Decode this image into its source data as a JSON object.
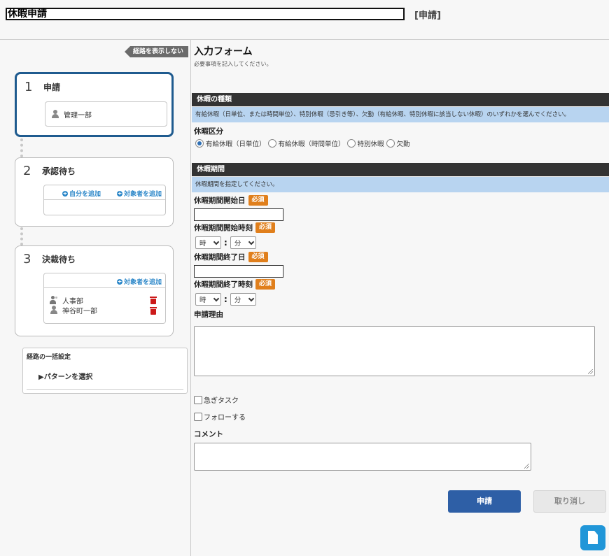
{
  "header": {
    "title": "休暇申請",
    "status": "[申請]"
  },
  "route": {
    "toggle_label": "経路を表示しない",
    "steps": [
      {
        "number": "1",
        "title": "申請",
        "members": [
          "管理一部"
        ]
      },
      {
        "number": "2",
        "title": "承認待ち",
        "add_self": "自分を追加",
        "add_target": "対象者を追加"
      },
      {
        "number": "3",
        "title": "決裁待ち",
        "add_target": "対象者を追加",
        "members": [
          "人事部",
          "神谷町一部"
        ]
      }
    ],
    "bulk": {
      "title": "経路の一括設定",
      "pattern_label": "▶パターンを選択"
    }
  },
  "form": {
    "title": "入力フォーム",
    "subtitle": "必要事項を記入してください。",
    "sections": [
      {
        "heading": "休暇の種類",
        "note": "有給休暇（日単位、または時間単位）、特別休暇（忌引き等）、欠勤（有給休暇、特別休暇に該当しない休暇）のいずれかを選んでください。"
      },
      {
        "heading": "休暇期間",
        "note": "休暇期間を指定してください。"
      }
    ],
    "leave_type": {
      "label": "休暇区分",
      "options": [
        "有給休暇（日単位）",
        "有給休暇（時間単位）",
        "特別休暇",
        "欠勤"
      ],
      "selected": "有給休暇（日単位）"
    },
    "required_badge": "必須",
    "start_date_label": "休暇期間開始日",
    "start_time_label": "休暇期間開始時刻",
    "end_date_label": "休暇期間終了日",
    "end_time_label": "休暇期間終了時刻",
    "hour_placeholder": "時",
    "minute_placeholder": "分",
    "colon": ":",
    "reason_label": "申請理由",
    "urgent_label": "急ぎタスク",
    "follow_label": "フォローする",
    "comment_label": "コメント",
    "submit_label": "申請",
    "cancel_label": "取り消し"
  },
  "icons": {
    "fab": "document-icon"
  },
  "colors": {
    "accent": "#1f5b8f",
    "primary_button": "#2e5fa6",
    "required": "#e07f1c",
    "section_header": "#333333",
    "section_note": "#b8d4f0",
    "link": "#2a86c8",
    "delete": "#cc1a1a",
    "fab": "#2196d8"
  }
}
